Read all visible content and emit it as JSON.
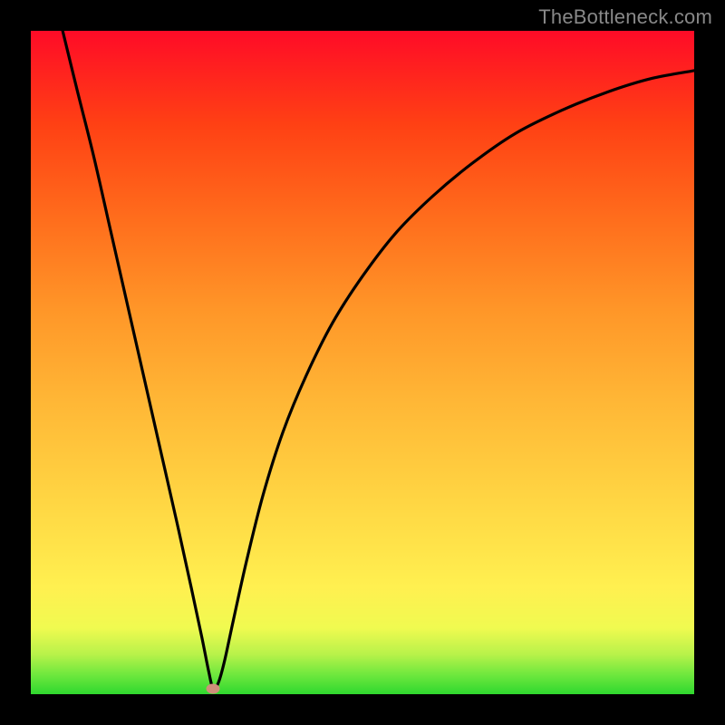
{
  "watermark": "TheBottleneck.com",
  "marker": {
    "x_frac": 0.275,
    "y_frac": 0.992
  },
  "colors": {
    "frame": "#000000",
    "curve": "#000000",
    "marker": "#cf8f7a",
    "gradient_top": "#ff0b27",
    "gradient_bottom": "#2fd82f"
  },
  "chart_data": {
    "type": "line",
    "title": "",
    "xlabel": "",
    "ylabel": "",
    "xlim": [
      0,
      1
    ],
    "ylim": [
      0,
      1
    ],
    "curve_points": [
      {
        "x": 0.048,
        "y": 1.0
      },
      {
        "x": 0.07,
        "y": 0.91
      },
      {
        "x": 0.095,
        "y": 0.81
      },
      {
        "x": 0.12,
        "y": 0.7
      },
      {
        "x": 0.145,
        "y": 0.59
      },
      {
        "x": 0.17,
        "y": 0.48
      },
      {
        "x": 0.195,
        "y": 0.37
      },
      {
        "x": 0.22,
        "y": 0.26
      },
      {
        "x": 0.242,
        "y": 0.16
      },
      {
        "x": 0.258,
        "y": 0.085
      },
      {
        "x": 0.268,
        "y": 0.035
      },
      {
        "x": 0.275,
        "y": 0.008
      },
      {
        "x": 0.283,
        "y": 0.018
      },
      {
        "x": 0.292,
        "y": 0.05
      },
      {
        "x": 0.305,
        "y": 0.11
      },
      {
        "x": 0.325,
        "y": 0.2
      },
      {
        "x": 0.35,
        "y": 0.3
      },
      {
        "x": 0.38,
        "y": 0.395
      },
      {
        "x": 0.415,
        "y": 0.48
      },
      {
        "x": 0.455,
        "y": 0.56
      },
      {
        "x": 0.5,
        "y": 0.63
      },
      {
        "x": 0.55,
        "y": 0.695
      },
      {
        "x": 0.605,
        "y": 0.75
      },
      {
        "x": 0.665,
        "y": 0.8
      },
      {
        "x": 0.73,
        "y": 0.845
      },
      {
        "x": 0.8,
        "y": 0.88
      },
      {
        "x": 0.87,
        "y": 0.908
      },
      {
        "x": 0.935,
        "y": 0.928
      },
      {
        "x": 1.0,
        "y": 0.94
      }
    ],
    "marker": {
      "x": 0.275,
      "y": 0.008
    }
  }
}
